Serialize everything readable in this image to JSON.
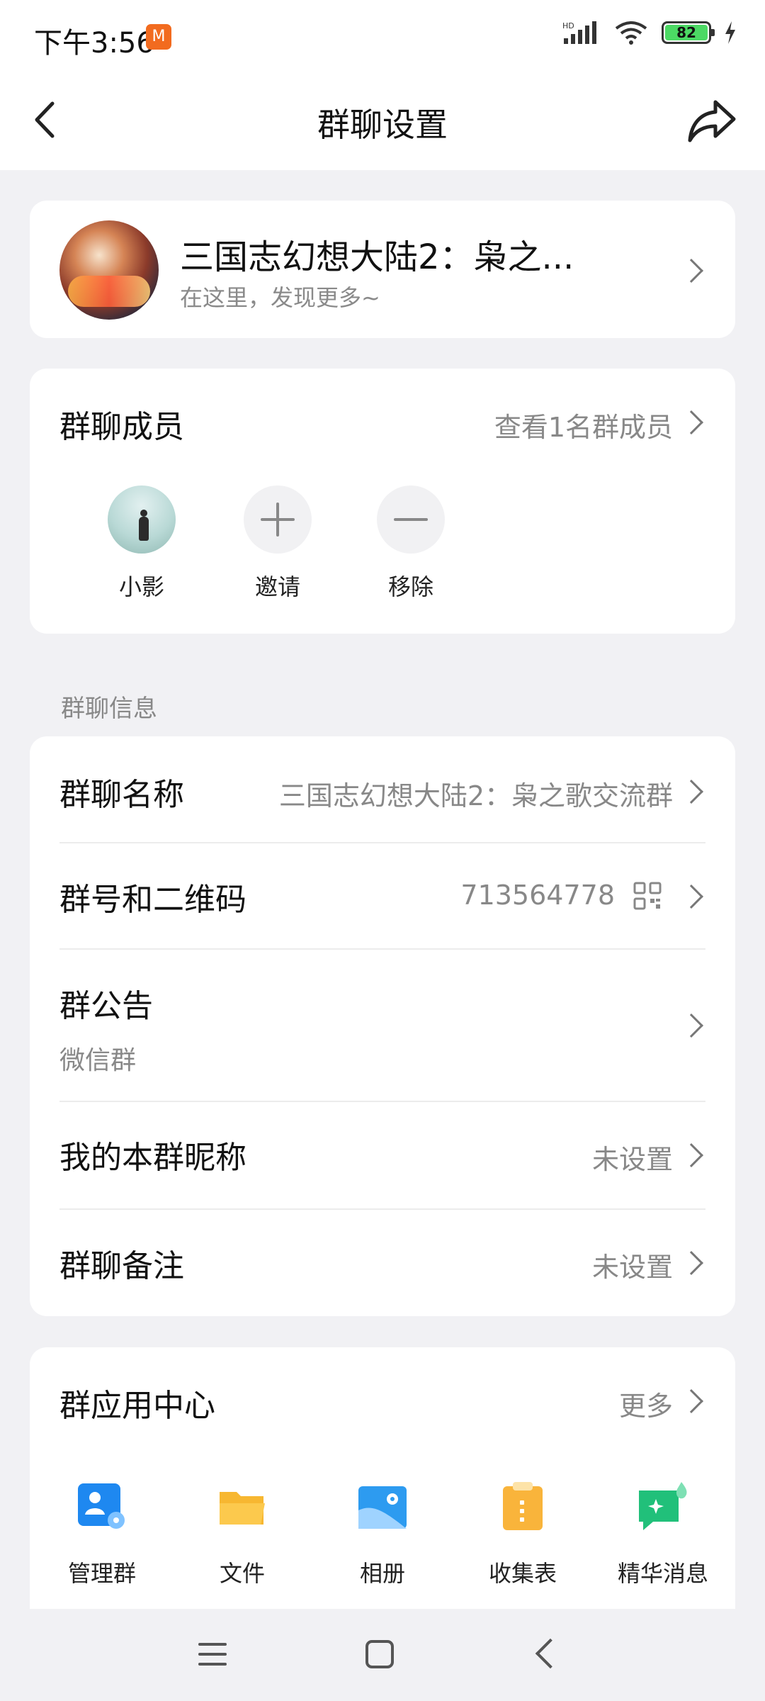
{
  "status": {
    "time": "下午3:56",
    "app_badge": "M",
    "network": "HD",
    "battery": "82"
  },
  "nav": {
    "title": "群聊设置"
  },
  "group": {
    "name": "三国志幻想大陆2：枭之...",
    "subtitle": "在这里，发现更多~"
  },
  "members": {
    "title": "群聊成员",
    "view_all": "查看1名群成员",
    "list": [
      {
        "label": "小影"
      },
      {
        "label": "邀请"
      },
      {
        "label": "移除"
      }
    ]
  },
  "info": {
    "section_label": "群聊信息",
    "group_name_title": "群聊名称",
    "group_name_value": "三国志幻想大陆2：枭之歌交流群",
    "group_id_title": "群号和二维码",
    "group_id_value": "713564778",
    "notice_title": "群公告",
    "notice_value": "微信群",
    "nickname_title": "我的本群昵称",
    "nickname_value": "未设置",
    "remark_title": "群聊备注",
    "remark_value": "未设置"
  },
  "apps": {
    "title": "群应用中心",
    "more": "更多",
    "items": [
      {
        "label": "管理群",
        "icon": "manage-group-icon",
        "color": "#1e88f0"
      },
      {
        "label": "文件",
        "icon": "folder-icon",
        "color": "#f7b731"
      },
      {
        "label": "相册",
        "icon": "album-icon",
        "color": "#2d9bf0"
      },
      {
        "label": "收集表",
        "icon": "clipboard-icon",
        "color": "#f9b43b"
      },
      {
        "label": "精华消息",
        "icon": "highlight-message-icon",
        "color": "#21c07a"
      }
    ]
  },
  "colors": {
    "background": "#f1f1f4",
    "card": "#ffffff",
    "secondary_text": "#888888"
  }
}
